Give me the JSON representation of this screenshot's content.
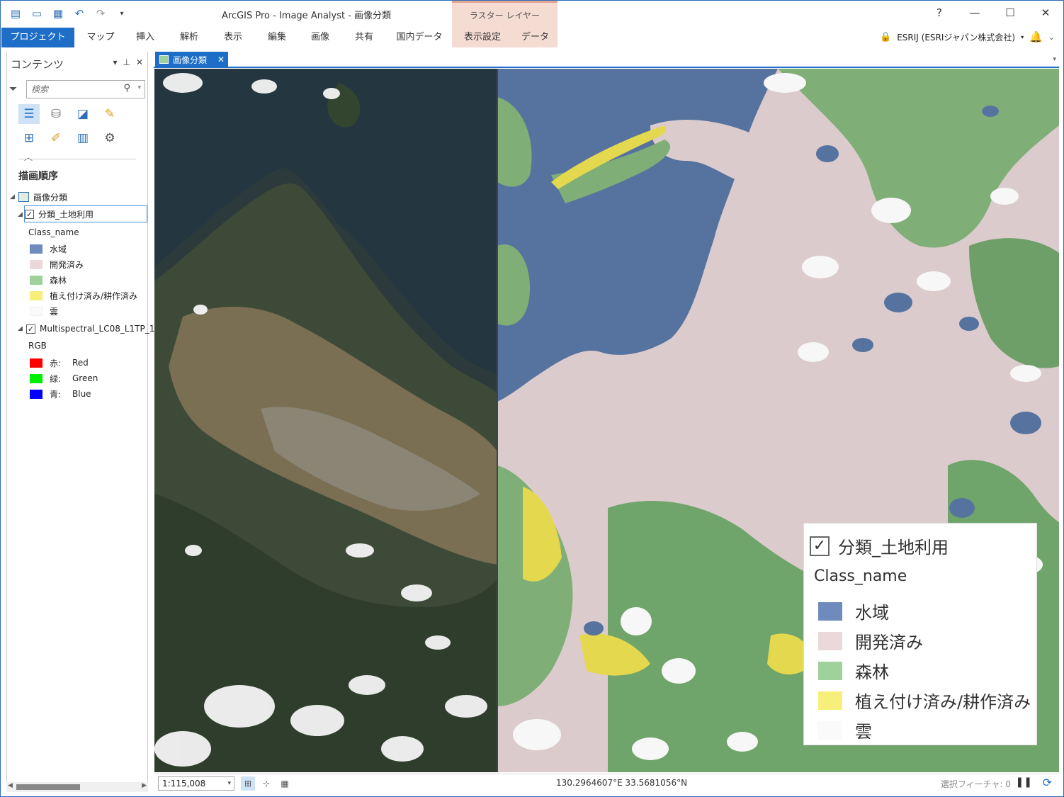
{
  "window": {
    "title": "ArcGIS Pro - Image Analyst - 画像分類",
    "controls": [
      "?",
      "—",
      "☐",
      "✕"
    ]
  },
  "quick_access": [
    "new-project-icon",
    "open-project-icon",
    "save-project-icon",
    "undo-icon",
    "redo-icon",
    "customize-icon"
  ],
  "ribbon": {
    "context_header": "ラスター レイヤー",
    "tabs": [
      "プロジェクト",
      "マップ",
      "挿入",
      "解析",
      "表示",
      "編集",
      "画像",
      "共有",
      "国内データ",
      "表示設定",
      "データ"
    ],
    "active_tab": "プロジェクト",
    "user": "ESRIJ (ESRIジャパン株式会社)"
  },
  "contents": {
    "title": "コンテンツ",
    "search_placeholder": "検索",
    "drawing_order_title": "描画順序",
    "map_name": "画像分類",
    "classified_layer": {
      "name": "分類_土地利用",
      "checked": true,
      "field": "Class_name",
      "classes": [
        {
          "label": "水域",
          "color": "#6f8bbd"
        },
        {
          "label": "開発済み",
          "color": "#ead8da"
        },
        {
          "label": "森林",
          "color": "#9fd29b"
        },
        {
          "label": "植え付け済み/耕作済み",
          "color": "#f6ef7a"
        },
        {
          "label": "雲",
          "color": "#fafafa"
        }
      ]
    },
    "imagery_layer": {
      "name": "Multispectral_LC08_L1TP_1",
      "checked": true,
      "renderer": "RGB",
      "bands": [
        {
          "channel": "赤:",
          "band": "Red",
          "color": "#ff0000"
        },
        {
          "channel": "緑:",
          "band": "Green",
          "color": "#00ee00"
        },
        {
          "channel": "青:",
          "band": "Blue",
          "color": "#0000ff"
        }
      ]
    }
  },
  "view": {
    "tab_label": "画像分類",
    "legend": {
      "layer": "分類_土地利用",
      "field": "Class_name",
      "items": [
        "水域",
        "開発済み",
        "森林",
        "植え付け済み/耕作済み",
        "雲"
      ]
    }
  },
  "status": {
    "scale": "1:115,008",
    "coordinates": "130.2964607°E 33.5681056°N",
    "selected_features": "選択フィーチャ: 0"
  }
}
